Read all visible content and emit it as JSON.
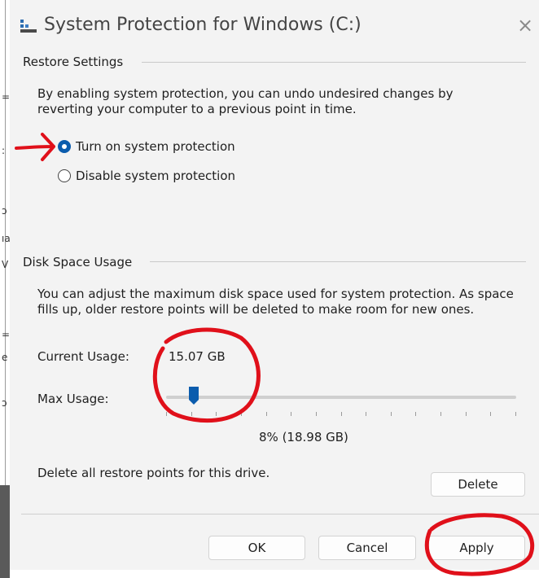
{
  "window": {
    "title": "System Protection for Windows (C:)",
    "close_glyph": "×"
  },
  "background_edge": [
    "=",
    ":",
    "ɔ",
    "ıa",
    "V",
    "=",
    "e",
    "ɔ"
  ],
  "restore_settings": {
    "title": "Restore Settings",
    "description_line1": "By enabling system protection, you can undo undesired changes by",
    "description_line2": "reverting your computer to a previous point in time.",
    "options": [
      {
        "label": "Turn on system protection",
        "selected": true
      },
      {
        "label": "Disable system protection",
        "selected": false
      }
    ]
  },
  "disk_space": {
    "title": "Disk Space Usage",
    "description_line1": "You can adjust the maximum disk space used for system protection. As space",
    "description_line2": "fills up, older restore points will be deleted to make room for new ones.",
    "current_usage_label": "Current Usage:",
    "current_usage_value": "15.07 GB",
    "max_usage_label": "Max Usage:",
    "max_usage_fraction": 0.08,
    "max_usage_value": "8% (18.98 GB)",
    "delete_text": "Delete all restore points for this drive.",
    "delete_label": "Delete"
  },
  "buttons": {
    "ok": "OK",
    "cancel": "Cancel",
    "apply": "Apply"
  },
  "colors": {
    "accent": "#0b5cad",
    "annotation": "#e0101a"
  }
}
